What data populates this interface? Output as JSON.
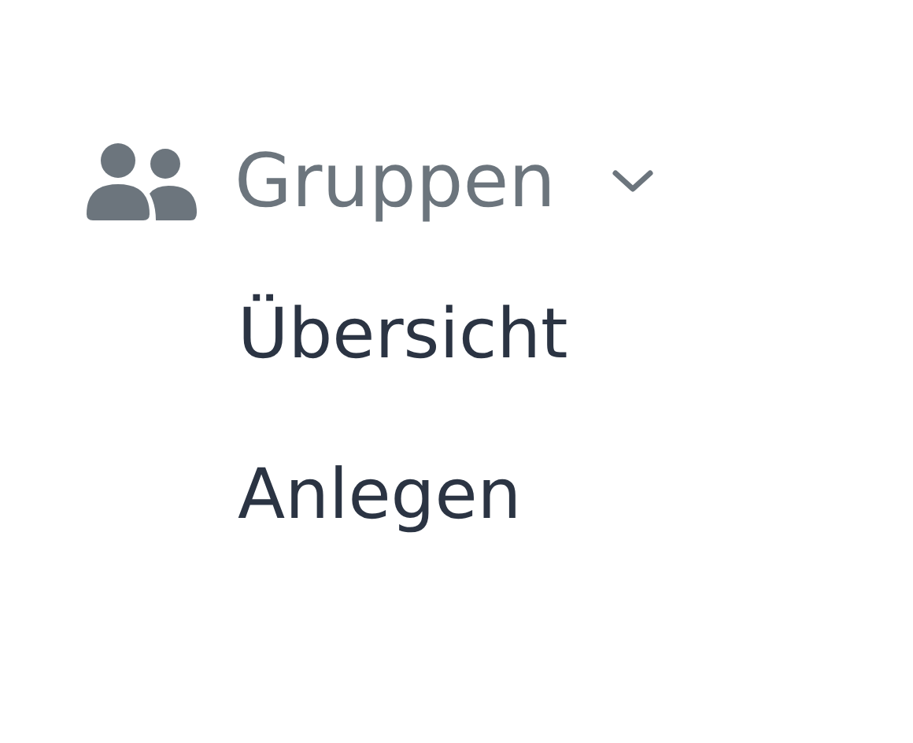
{
  "menu": {
    "label": "Gruppen",
    "expanded": true,
    "items": [
      {
        "label": "Übersicht"
      },
      {
        "label": "Anlegen"
      }
    ]
  }
}
